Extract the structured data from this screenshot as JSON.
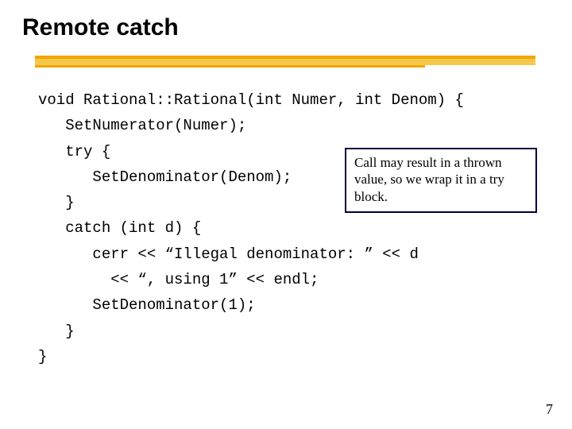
{
  "title": "Remote catch",
  "code": "void Rational::Rational(int Numer, int Denom) {\n   SetNumerator(Numer);\n   try {\n      SetDenominator(Denom);\n   }\n   catch (int d) {\n      cerr << “Illegal denominator: ” << d\n        << “, using 1” << endl;\n      SetDenominator(1);\n   }\n}",
  "callout": "Call may result in a thrown value, so we wrap it in a try block.",
  "page_number": "7"
}
